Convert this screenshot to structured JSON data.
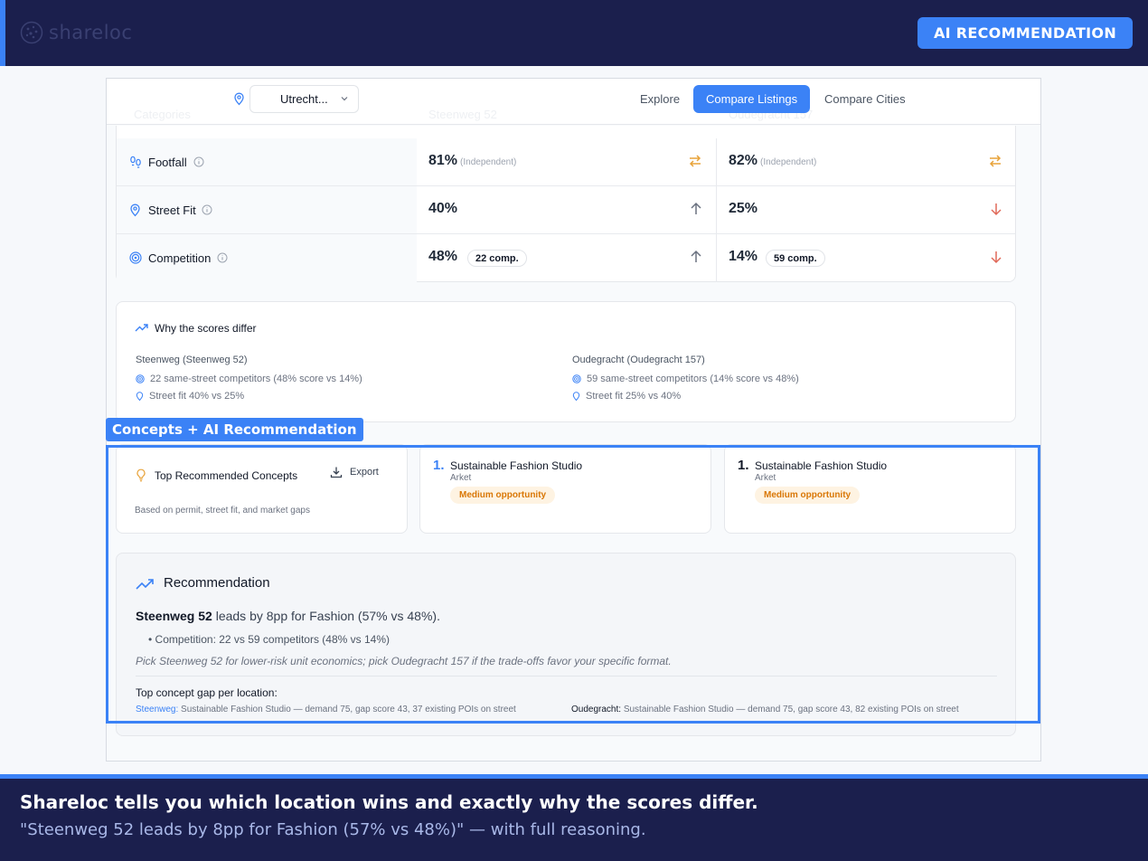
{
  "brand": {
    "name": "shareloc",
    "logo_icon": "globe-dots-icon"
  },
  "header": {
    "ai_button": "AI RECOMMENDATION"
  },
  "toolbar": {
    "city_select": "Utrecht...",
    "nav": [
      "Explore",
      "Compare Listings",
      "Compare Cities"
    ],
    "active_nav": "Compare Listings",
    "ghost_labels": [
      "Categories",
      "Steenweg 52",
      "Oudegracht 157"
    ]
  },
  "metrics": [
    {
      "label": "Footfall",
      "icon": "footsteps-icon",
      "a_value": "81%",
      "a_sub": "(Independent)",
      "a_trend": "swap-icon",
      "b_value": "82%",
      "b_sub": "(Independent)",
      "b_trend": "swap-icon"
    },
    {
      "label": "Street Fit",
      "icon": "map-pin-icon",
      "a_value": "40%",
      "a_trend": "arrow-up-icon",
      "b_value": "25%",
      "b_trend": "arrow-down-icon"
    },
    {
      "label": "Competition",
      "icon": "target-icon",
      "a_value": "48%",
      "a_pill": "22 comp.",
      "a_trend": "arrow-up-icon",
      "b_value": "14%",
      "b_pill": "59 comp.",
      "b_trend": "arrow-down-icon"
    }
  ],
  "why": {
    "title": "Why the scores differ",
    "left": {
      "heading": "Steenweg (Steenweg 52)",
      "lines": [
        "22 same-street competitors (48% score vs 14%)",
        "Street fit 40% vs 25%"
      ]
    },
    "right": {
      "heading": "Oudegracht (Oudegracht 157)",
      "lines": [
        "59 same-street competitors (14% score vs 48%)",
        "Street fit 25% vs 40%"
      ]
    }
  },
  "highlight_label": "Concepts + AI Recommendation",
  "concepts": {
    "title": "Top Recommended Concepts",
    "export": "Export",
    "subtitle": "Based on permit, street fit, and market gaps",
    "cards": [
      {
        "rank": "1.",
        "name": "Sustainable Fashion Studio",
        "brand": "Arket",
        "badge": "Medium opportunity"
      },
      {
        "rank": "1.",
        "name": "Sustainable Fashion Studio",
        "brand": "Arket",
        "badge": "Medium opportunity"
      }
    ]
  },
  "recommendation": {
    "title": "Recommendation",
    "lead_bold": "Steenweg 52",
    "lead_rest": " leads by 8pp for Fashion (57% vs 48%).",
    "bullet": "• Competition: 22 vs 59 competitors (48% vs 14%)",
    "italic": "Pick Steenweg 52 for lower-risk unit economics; pick Oudegracht 157 if the trade-offs favor your specific format.",
    "gap_heading": "Top concept gap per location:",
    "gaps": [
      {
        "key": "Steenweg:",
        "text": " Sustainable Fashion Studio — demand 75, gap score 43, 37 existing POIs on street"
      },
      {
        "key": "Oudegracht:",
        "text": " Sustainable Fashion Studio — demand 75, gap score 43, 82 existing POIs on street"
      }
    ]
  },
  "caption": {
    "headline": "Shareloc tells you which location wins and exactly why the scores differ.",
    "sub": "\"Steenweg 52 leads by 8pp for Fashion (57% vs 48%)\" — with full reasoning."
  },
  "colors": {
    "navy": "#1b1f4d",
    "accent": "#3b82f6",
    "up": "#6b7280",
    "down": "#e06a5a",
    "swap": "#e8a33a"
  }
}
